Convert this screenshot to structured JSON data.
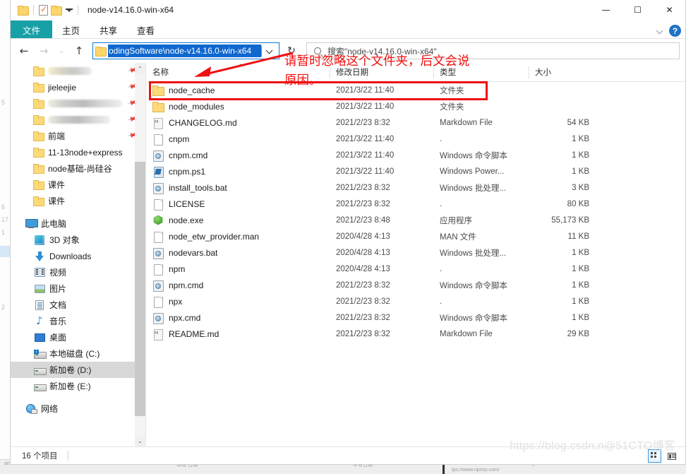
{
  "window": {
    "title": "node-v14.16.0-win-x64",
    "quick_access": [
      "folder-icon",
      "properties-icon",
      "new-folder-icon",
      "customize-caret"
    ],
    "controls": {
      "minimize": "—",
      "maximize": "☐",
      "close": "✕"
    }
  },
  "ribbon": {
    "tabs": [
      {
        "label": "文件",
        "active": true
      },
      {
        "label": "主页",
        "active": false
      },
      {
        "label": "共享",
        "active": false
      },
      {
        "label": "查看",
        "active": false
      }
    ],
    "collapse_icon": "chevron-down-icon",
    "help_label": "?",
    "accent_color": "#17a0a6"
  },
  "navbar": {
    "back": "←",
    "forward": "→",
    "recent": "⌄",
    "up": "↑",
    "address_value": "odingSoftware\\node-v14.16.0-win-x64",
    "address_dropdown": "chevron-down-icon",
    "refresh": "↻",
    "search_placeholder": "搜索\"node-v14.16.0-win-x64\""
  },
  "sidebar": {
    "items": [
      {
        "label": "",
        "icon": "folder-icon",
        "pinned": true,
        "redacted": true,
        "redact_width": 62,
        "indent": 30
      },
      {
        "label": "jieleejie",
        "icon": "folder-icon",
        "pinned": true,
        "indent": 30
      },
      {
        "label": "",
        "icon": "folder-icon",
        "pinned": true,
        "redacted": true,
        "redact_width": 105,
        "indent": 30
      },
      {
        "label": "",
        "icon": "folder-icon",
        "pinned": true,
        "redacted": true,
        "redact_width": 88,
        "indent": 30
      },
      {
        "label": "前端",
        "icon": "folder-icon",
        "pinned": true,
        "indent": 30
      },
      {
        "label": "11-13node+express",
        "icon": "folder-icon",
        "pinned": false,
        "indent": 30
      },
      {
        "label": "node基础-尚硅谷",
        "icon": "folder-icon",
        "pinned": false,
        "indent": 30
      },
      {
        "label": "课件",
        "icon": "folder-icon",
        "pinned": false,
        "indent": 30
      },
      {
        "label": "课件",
        "icon": "folder-icon",
        "pinned": false,
        "indent": 30
      },
      {
        "gap": true
      },
      {
        "label": "此电脑",
        "icon": "this-pc-icon",
        "indent": 20
      },
      {
        "label": "3D 对象",
        "icon": "3d-objects-icon",
        "indent": 32
      },
      {
        "label": "Downloads",
        "icon": "downloads-icon",
        "indent": 32
      },
      {
        "label": "视频",
        "icon": "videos-icon",
        "indent": 32
      },
      {
        "label": "图片",
        "icon": "pictures-icon",
        "indent": 32
      },
      {
        "label": "文档",
        "icon": "documents-icon",
        "indent": 32
      },
      {
        "label": "音乐",
        "icon": "music-icon",
        "indent": 32
      },
      {
        "label": "桌面",
        "icon": "desktop-icon",
        "indent": 32
      },
      {
        "label": "本地磁盘 (C:)",
        "icon": "drive-icon",
        "indent": 32
      },
      {
        "label": "新加卷 (D:)",
        "icon": "drive-icon",
        "indent": 32,
        "selected": true
      },
      {
        "label": "新加卷 (E:)",
        "icon": "drive-icon",
        "indent": 32
      },
      {
        "gap": true
      },
      {
        "label": "网络",
        "icon": "network-icon",
        "indent": 20
      }
    ],
    "scroll_up": "⌃",
    "scroll_down": "⌄"
  },
  "columns": [
    {
      "label": "名称",
      "sorted": true,
      "sort_dir": "asc"
    },
    {
      "label": "修改日期"
    },
    {
      "label": "类型"
    },
    {
      "label": "大小"
    }
  ],
  "files": [
    {
      "name": "node_cache",
      "icon": "folder-icon",
      "date": "2021/3/22 11:40",
      "type": "文件夹",
      "size": ""
    },
    {
      "name": "node_modules",
      "icon": "folder-icon",
      "date": "2021/3/22 11:40",
      "type": "文件夹",
      "size": ""
    },
    {
      "name": "CHANGELOG.md",
      "icon": "markdown-file-icon",
      "date": "2021/2/23 8:32",
      "type": "Markdown File",
      "size": "54 KB"
    },
    {
      "name": "cnpm",
      "icon": "blank-file-icon",
      "date": "2021/3/22 11:40",
      "type": ".",
      "size": "1 KB"
    },
    {
      "name": "cnpm.cmd",
      "icon": "cmd-script-icon",
      "date": "2021/3/22 11:40",
      "type": "Windows 命令脚本",
      "size": "1 KB"
    },
    {
      "name": "cnpm.ps1",
      "icon": "powershell-file-icon",
      "date": "2021/3/22 11:40",
      "type": "Windows Power...",
      "size": "1 KB"
    },
    {
      "name": "install_tools.bat",
      "icon": "cmd-script-icon",
      "date": "2021/2/23 8:32",
      "type": "Windows 批处理...",
      "size": "3 KB"
    },
    {
      "name": "LICENSE",
      "icon": "blank-file-icon",
      "date": "2021/2/23 8:32",
      "type": ".",
      "size": "80 KB"
    },
    {
      "name": "node.exe",
      "icon": "nodejs-exe-icon",
      "date": "2021/2/23 8:48",
      "type": "应用程序",
      "size": "55,173 KB"
    },
    {
      "name": "node_etw_provider.man",
      "icon": "blank-file-icon",
      "date": "2020/4/28 4:13",
      "type": "MAN 文件",
      "size": "11 KB"
    },
    {
      "name": "nodevars.bat",
      "icon": "cmd-script-icon",
      "date": "2020/4/28 4:13",
      "type": "Windows 批处理...",
      "size": "1 KB"
    },
    {
      "name": "npm",
      "icon": "blank-file-icon",
      "date": "2020/4/28 4:13",
      "type": ".",
      "size": "1 KB"
    },
    {
      "name": "npm.cmd",
      "icon": "cmd-script-icon",
      "date": "2021/2/23 8:32",
      "type": "Windows 命令脚本",
      "size": "1 KB"
    },
    {
      "name": "npx",
      "icon": "blank-file-icon",
      "date": "2021/2/23 8:32",
      "type": ".",
      "size": "1 KB"
    },
    {
      "name": "npx.cmd",
      "icon": "cmd-script-icon",
      "date": "2021/2/23 8:32",
      "type": "Windows 命令脚本",
      "size": "1 KB"
    },
    {
      "name": "README.md",
      "icon": "markdown-file-icon",
      "date": "2021/2/23 8:32",
      "type": "Markdown File",
      "size": "29 KB"
    }
  ],
  "annotation": {
    "text": "请暂时忽略这个文件夹，后文会说原因。",
    "color": "#f01010",
    "target_row": "node_cache"
  },
  "statusbar": {
    "count": "16 个项目",
    "view_buttons": [
      "large-icons-view-icon",
      "details-view-icon"
    ],
    "active_view": "details-view-icon"
  },
  "watermark": "https://blog.csdn.n@51CTO博客"
}
